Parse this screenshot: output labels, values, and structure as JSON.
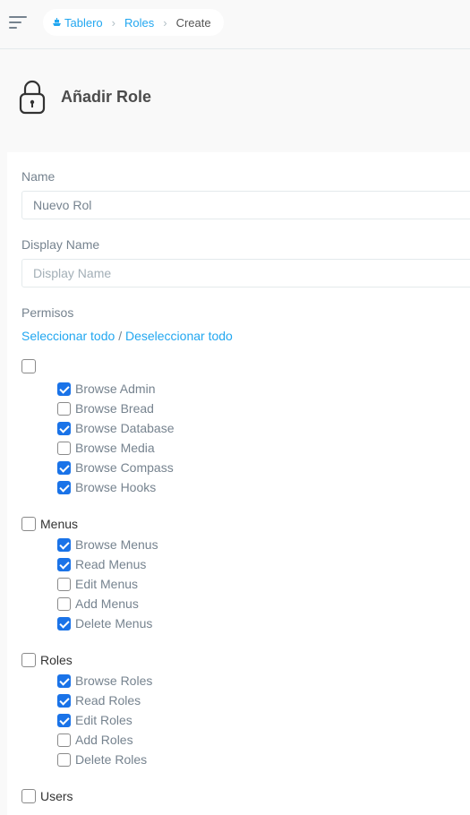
{
  "breadcrumb": {
    "home": "Tablero",
    "roles": "Roles",
    "current": "Create"
  },
  "page": {
    "title": "Añadir Role"
  },
  "form": {
    "name_label": "Name",
    "name_value": "Nuevo Rol",
    "display_label": "Display Name",
    "display_placeholder": "Display Name",
    "permissions_label": "Permisos",
    "select_all": "Seleccionar todo",
    "separator": "/",
    "deselect_all": "Deseleccionar todo"
  },
  "groups": [
    {
      "name": "",
      "checked": false,
      "permissions": [
        {
          "label": "Browse Admin",
          "checked": true
        },
        {
          "label": "Browse Bread",
          "checked": false
        },
        {
          "label": "Browse Database",
          "checked": true
        },
        {
          "label": "Browse Media",
          "checked": false
        },
        {
          "label": "Browse Compass",
          "checked": true
        },
        {
          "label": "Browse Hooks",
          "checked": true
        }
      ]
    },
    {
      "name": "Menus",
      "checked": false,
      "permissions": [
        {
          "label": "Browse Menus",
          "checked": true
        },
        {
          "label": "Read Menus",
          "checked": true
        },
        {
          "label": "Edit Menus",
          "checked": false
        },
        {
          "label": "Add Menus",
          "checked": false
        },
        {
          "label": "Delete Menus",
          "checked": true
        }
      ]
    },
    {
      "name": "Roles",
      "checked": false,
      "permissions": [
        {
          "label": "Browse Roles",
          "checked": true
        },
        {
          "label": "Read Roles",
          "checked": true
        },
        {
          "label": "Edit Roles",
          "checked": true
        },
        {
          "label": "Add Roles",
          "checked": false
        },
        {
          "label": "Delete Roles",
          "checked": false
        }
      ]
    },
    {
      "name": "Users",
      "checked": false,
      "permissions": []
    }
  ]
}
